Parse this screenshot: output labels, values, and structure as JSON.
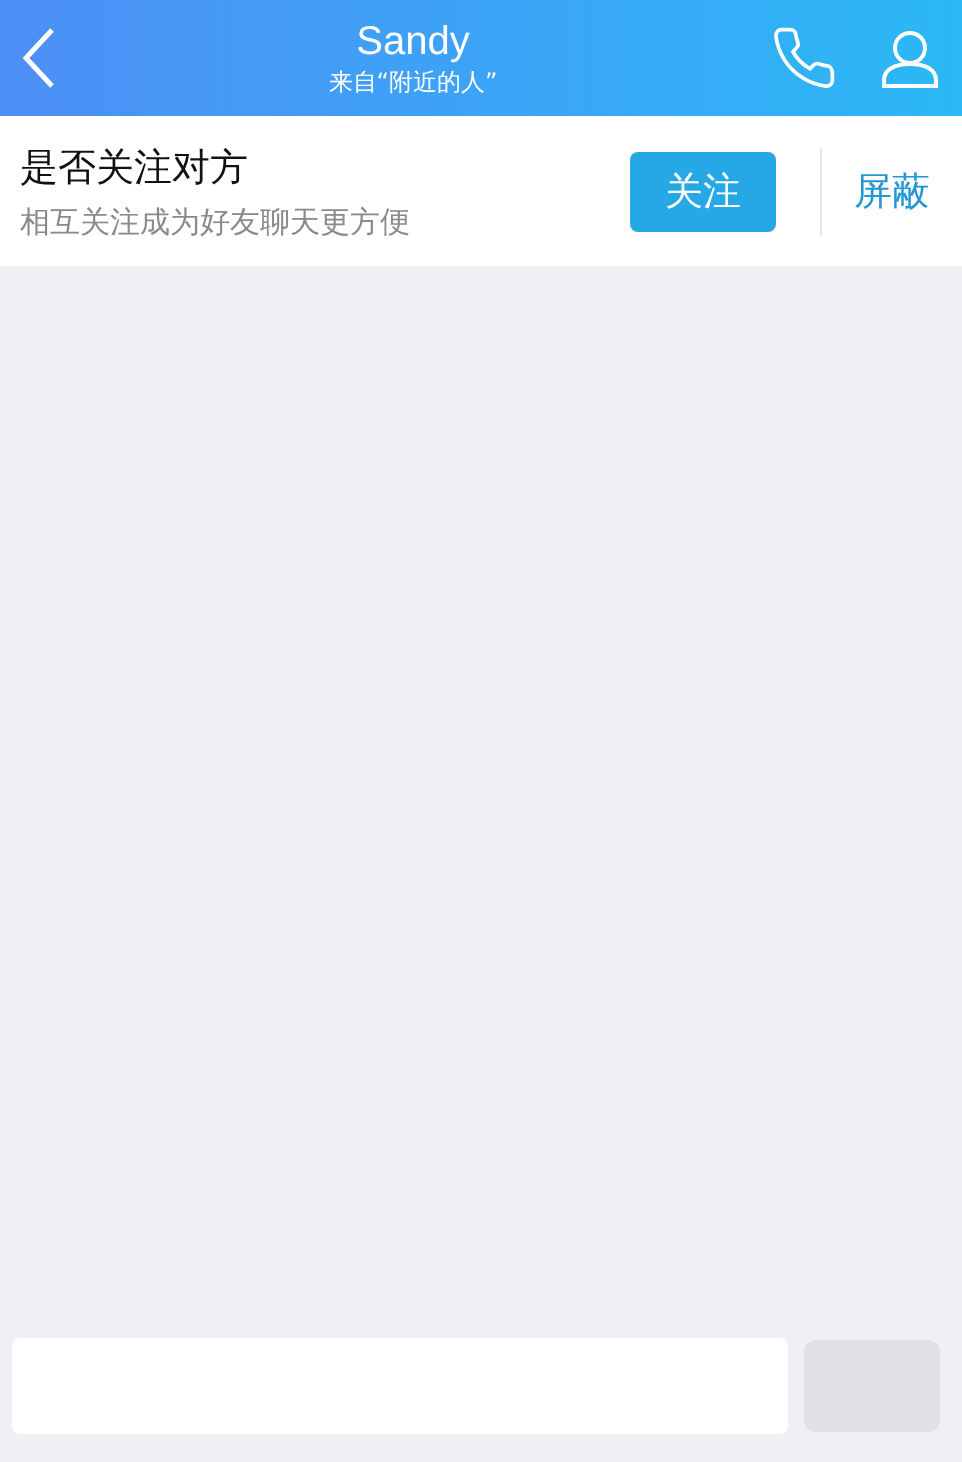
{
  "header": {
    "title": "Sandy",
    "subtitle": "来自“附近的人”"
  },
  "follow_prompt": {
    "title": "是否关注对方",
    "subtitle": "相互关注成为好友聊天更方便",
    "follow_button": "关注",
    "block_button": "屏蔽"
  }
}
